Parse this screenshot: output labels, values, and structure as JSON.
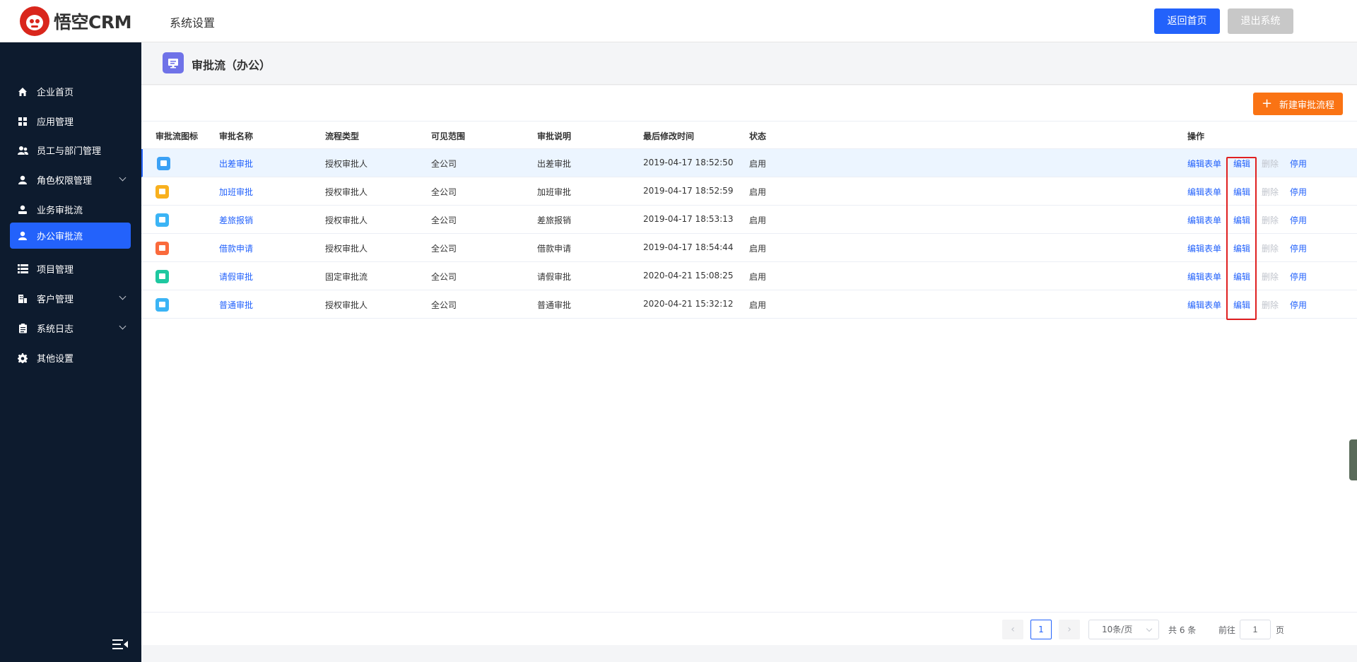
{
  "header": {
    "logo_text": "悟空CRM",
    "title": "系统设置",
    "home_button": "返回首页",
    "exit_button": "退出系统"
  },
  "sidebar": {
    "items": [
      {
        "label": "企业首页",
        "icon": "home-icon",
        "expandable": false,
        "active": false
      },
      {
        "label": "应用管理",
        "icon": "grid-icon",
        "expandable": false,
        "active": false
      },
      {
        "label": "员工与部门管理",
        "icon": "users-icon",
        "expandable": false,
        "active": false
      },
      {
        "label": "角色权限管理",
        "icon": "user-icon",
        "expandable": true,
        "active": false
      },
      {
        "label": "业务审批流",
        "icon": "user-check-icon",
        "expandable": false,
        "active": false
      },
      {
        "label": "办公审批流",
        "icon": "user-icon",
        "expandable": false,
        "active": true
      },
      {
        "label": "项目管理",
        "icon": "list-icon",
        "expandable": false,
        "active": false
      },
      {
        "label": "客户管理",
        "icon": "building-icon",
        "expandable": true,
        "active": false
      },
      {
        "label": "系统日志",
        "icon": "clipboard-icon",
        "expandable": true,
        "active": false
      },
      {
        "label": "其他设置",
        "icon": "gear-icon",
        "expandable": false,
        "active": false
      }
    ]
  },
  "page": {
    "title": "审批流（办公）",
    "new_button": "新建审批流程"
  },
  "table": {
    "headers": {
      "icon": "审批流图标",
      "name": "审批名称",
      "type": "流程类型",
      "scope": "可见范围",
      "desc": "审批说明",
      "updated": "最后修改时间",
      "status": "状态",
      "ops": "操作"
    },
    "rows": [
      {
        "icon_color": "#3ba1f5",
        "name": "出差审批",
        "type": "授权审批人",
        "scope": "全公司",
        "desc": "出差审批",
        "updated": "2019-04-17 18:52:50",
        "status": "启用"
      },
      {
        "icon_color": "#f8b01e",
        "name": "加班审批",
        "type": "授权审批人",
        "scope": "全公司",
        "desc": "加班审批",
        "updated": "2019-04-17 18:52:59",
        "status": "启用"
      },
      {
        "icon_color": "#3bb4f5",
        "name": "差旅报销",
        "type": "授权审批人",
        "scope": "全公司",
        "desc": "差旅报销",
        "updated": "2019-04-17 18:53:13",
        "status": "启用"
      },
      {
        "icon_color": "#fa6a3c",
        "name": "借款申请",
        "type": "授权审批人",
        "scope": "全公司",
        "desc": "借款申请",
        "updated": "2019-04-17 18:54:44",
        "status": "启用"
      },
      {
        "icon_color": "#1ec8a0",
        "name": "请假审批",
        "type": "固定审批流",
        "scope": "全公司",
        "desc": "请假审批",
        "updated": "2020-04-21 15:08:25",
        "status": "启用"
      },
      {
        "icon_color": "#3bb4f5",
        "name": "普通审批",
        "type": "授权审批人",
        "scope": "全公司",
        "desc": "普通审批",
        "updated": "2020-04-21 15:32:12",
        "status": "启用"
      }
    ],
    "actions": {
      "edit_form": "编辑表单",
      "edit": "编辑",
      "delete": "删除",
      "disable": "停用"
    }
  },
  "pagination": {
    "current_page": "1",
    "page_size": "10条/页",
    "total": "共 6 条",
    "goto_label": "前往",
    "goto_value": "1",
    "page_unit": "页"
  },
  "colors": {
    "primary": "#2362fb",
    "sidebar_bg": "#0d1b2e",
    "accent_orange": "#fa7314",
    "highlight_box": "#e02020"
  }
}
